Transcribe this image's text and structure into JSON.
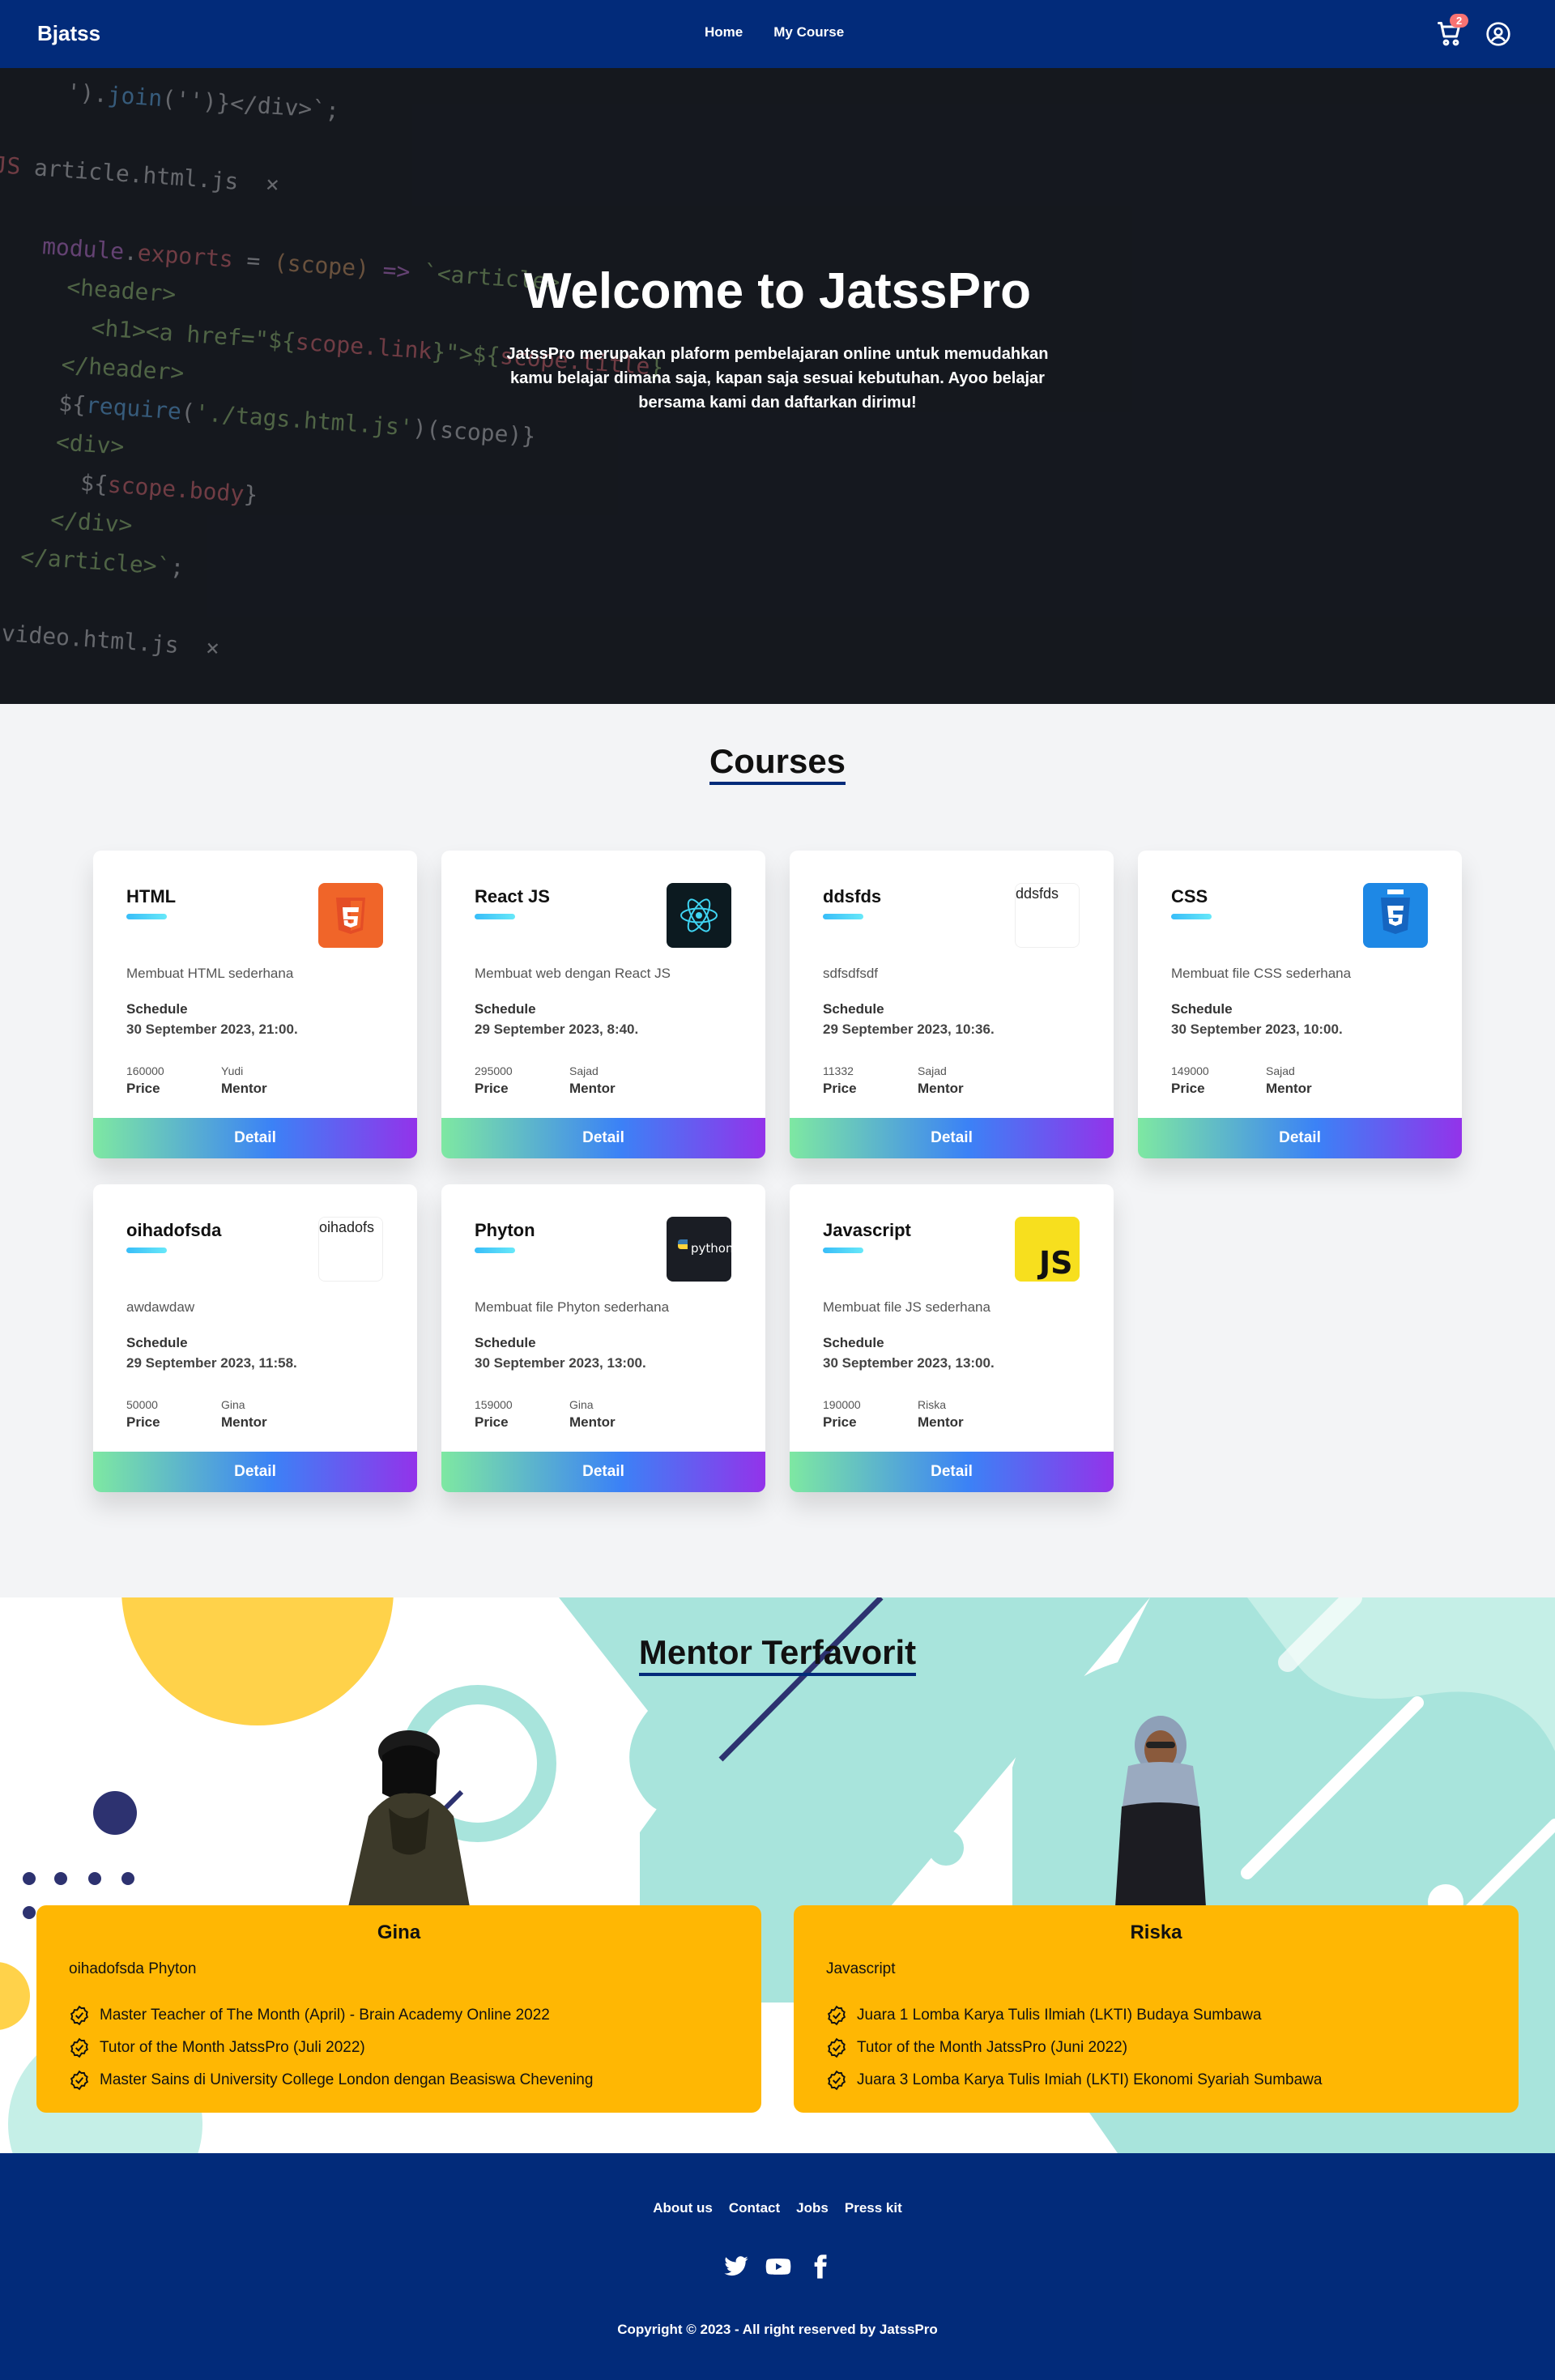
{
  "nav": {
    "brand": "Bjatss",
    "links": [
      "Home",
      "My Course"
    ],
    "cart_count": "2",
    "icons": [
      "cart-icon",
      "user-circle-icon"
    ]
  },
  "hero": {
    "title": "Welcome to JatssPro",
    "text": "JatssPro merupakan plaform pembelajaran online untuk memudahkan kamu belajar dimana saja, kapan saja sesuai kebutuhan. Ayoo belajar bersama kami dan daftarkan dirimu!"
  },
  "courses": {
    "title": "Courses",
    "schedule_label": "Schedule",
    "price_label": "Price",
    "mentor_label": "Mentor",
    "button_label": "Detail",
    "items": [
      {
        "title": "HTML",
        "desc": "Membuat HTML sederhana",
        "schedule": "30 September 2023, 21:00.",
        "price": "160000",
        "mentor": "Yudi",
        "img": "html5-logo"
      },
      {
        "title": "React JS",
        "desc": "Membuat web dengan React JS",
        "schedule": "29 September 2023, 8:40.",
        "price": "295000",
        "mentor": "Sajad",
        "img": "react-logo"
      },
      {
        "title": "ddsfds",
        "desc": "sdfsdfsdf",
        "schedule": "29 September 2023, 10:36.",
        "price": "11332",
        "mentor": "Sajad",
        "img_alt": "ddsfds"
      },
      {
        "title": "CSS",
        "desc": "Membuat file CSS sederhana",
        "schedule": "30 September 2023, 10:00.",
        "price": "149000",
        "mentor": "Sajad",
        "img": "css3-logo"
      },
      {
        "title": "oihadofsda",
        "desc": "awdawdaw",
        "schedule": "29 September 2023, 11:58.",
        "price": "50000",
        "mentor": "Gina",
        "img_alt": "oihadofs"
      },
      {
        "title": "Phyton",
        "desc": "Membuat file Phyton sederhana",
        "schedule": "30 September 2023, 13:00.",
        "price": "159000",
        "mentor": "Gina",
        "img": "python-logo",
        "img_text": "python"
      },
      {
        "title": "Javascript",
        "desc": "Membuat file JS sederhana",
        "schedule": "30 September 2023, 13:00.",
        "price": "190000",
        "mentor": "Riska",
        "img": "js-logo",
        "img_text": "JS"
      }
    ]
  },
  "mentors": {
    "title": "Mentor Terfavorit",
    "items": [
      {
        "name": "Gina",
        "courses": "oihadofsda  Phyton",
        "achievements": [
          "Master Teacher of The Month (April) - Brain Academy Online 2022",
          "Tutor of the Month JatssPro (Juli 2022)",
          "Master Sains di University College London dengan Beasiswa Chevening"
        ]
      },
      {
        "name": "Riska",
        "courses": "Javascript",
        "achievements": [
          "Juara 1 Lomba Karya Tulis Ilmiah (LKTI) Budaya Sumbawa",
          "Tutor of the Month JatssPro (Juni 2022)",
          "Juara 3 Lomba Karya Tulis Imiah (LKTI) Ekonomi Syariah Sumbawa"
        ]
      }
    ]
  },
  "footer": {
    "links": [
      "About us",
      "Contact",
      "Jobs",
      "Press kit"
    ],
    "socials": [
      "twitter-icon",
      "youtube-icon",
      "facebook-icon"
    ],
    "copyright": "Copyright © 2023 - All right reserved by JatssPro"
  },
  "colors": {
    "nav": "#022b7a",
    "mentor_card": "#ffb703",
    "accent": "#38bdf8",
    "teal": "#a8e4dc"
  }
}
